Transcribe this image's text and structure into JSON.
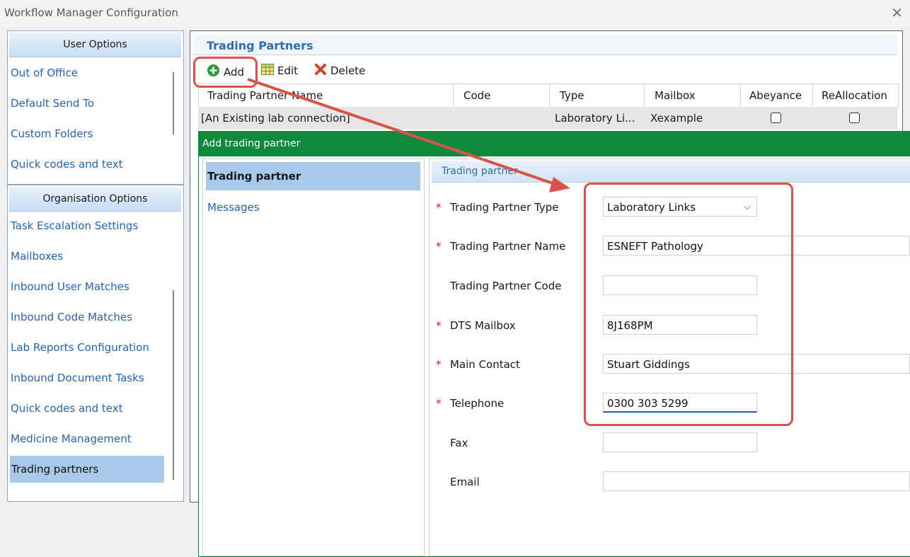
{
  "window": {
    "title": "Workflow Manager Configuration"
  },
  "sidebar": {
    "user_options": {
      "header": "User Options",
      "items": [
        "Out of Office",
        "Default Send To",
        "Custom Folders",
        "Quick codes and text"
      ]
    },
    "organisation_options": {
      "header": "Organisation Options",
      "items": [
        "Task Escalation Settings",
        "Mailboxes",
        "Inbound User Matches",
        "Inbound Code Matches",
        "Lab Reports Configuration",
        "Inbound Document Tasks",
        "Quick codes and text",
        "Medicine Management",
        "Trading partners"
      ],
      "selected": "Trading partners"
    }
  },
  "trading_partners": {
    "title": "Trading Partners",
    "toolbar": {
      "add": "Add",
      "edit": "Edit",
      "delete": "Delete"
    },
    "columns": [
      "Trading Partner Name",
      "Code",
      "Type",
      "Mailbox",
      "Abeyance",
      "ReAllocation"
    ],
    "rows": [
      {
        "name": "[An Existing lab connection]",
        "code": "",
        "type": "Laboratory Li...",
        "mailbox": "Xexample",
        "abeyance": false,
        "reallocation": false
      }
    ]
  },
  "dialog": {
    "title": "Add trading partner",
    "nav": [
      "Trading partner",
      "Messages"
    ],
    "nav_selected": "Trading partner",
    "section_title": "Trading partner",
    "fields": {
      "type": {
        "label": "Trading Partner Type",
        "value": "Laboratory Links",
        "required": "*"
      },
      "name": {
        "label": "Trading Partner Name",
        "value": "ESNEFT Pathology",
        "required": "*"
      },
      "code": {
        "label": "Trading Partner Code",
        "value": ""
      },
      "dts": {
        "label": "DTS Mailbox",
        "value": "8J168PM",
        "required": "*"
      },
      "contact": {
        "label": "Main Contact",
        "value": "Stuart Giddings",
        "required": "*"
      },
      "telephone": {
        "label": "Telephone",
        "value": "0300 303 5299",
        "required": "*"
      },
      "fax": {
        "label": "Fax",
        "value": ""
      },
      "email": {
        "label": "Email",
        "value": ""
      }
    }
  },
  "colors": {
    "accent_red": "#d9534a",
    "dialog_green": "#0f893b",
    "link_blue": "#2763b7"
  },
  "icons": [
    "add-icon",
    "edit-grid-icon",
    "delete-icon",
    "chevron-down-icon",
    "close-icon",
    "arrow-annotation"
  ]
}
